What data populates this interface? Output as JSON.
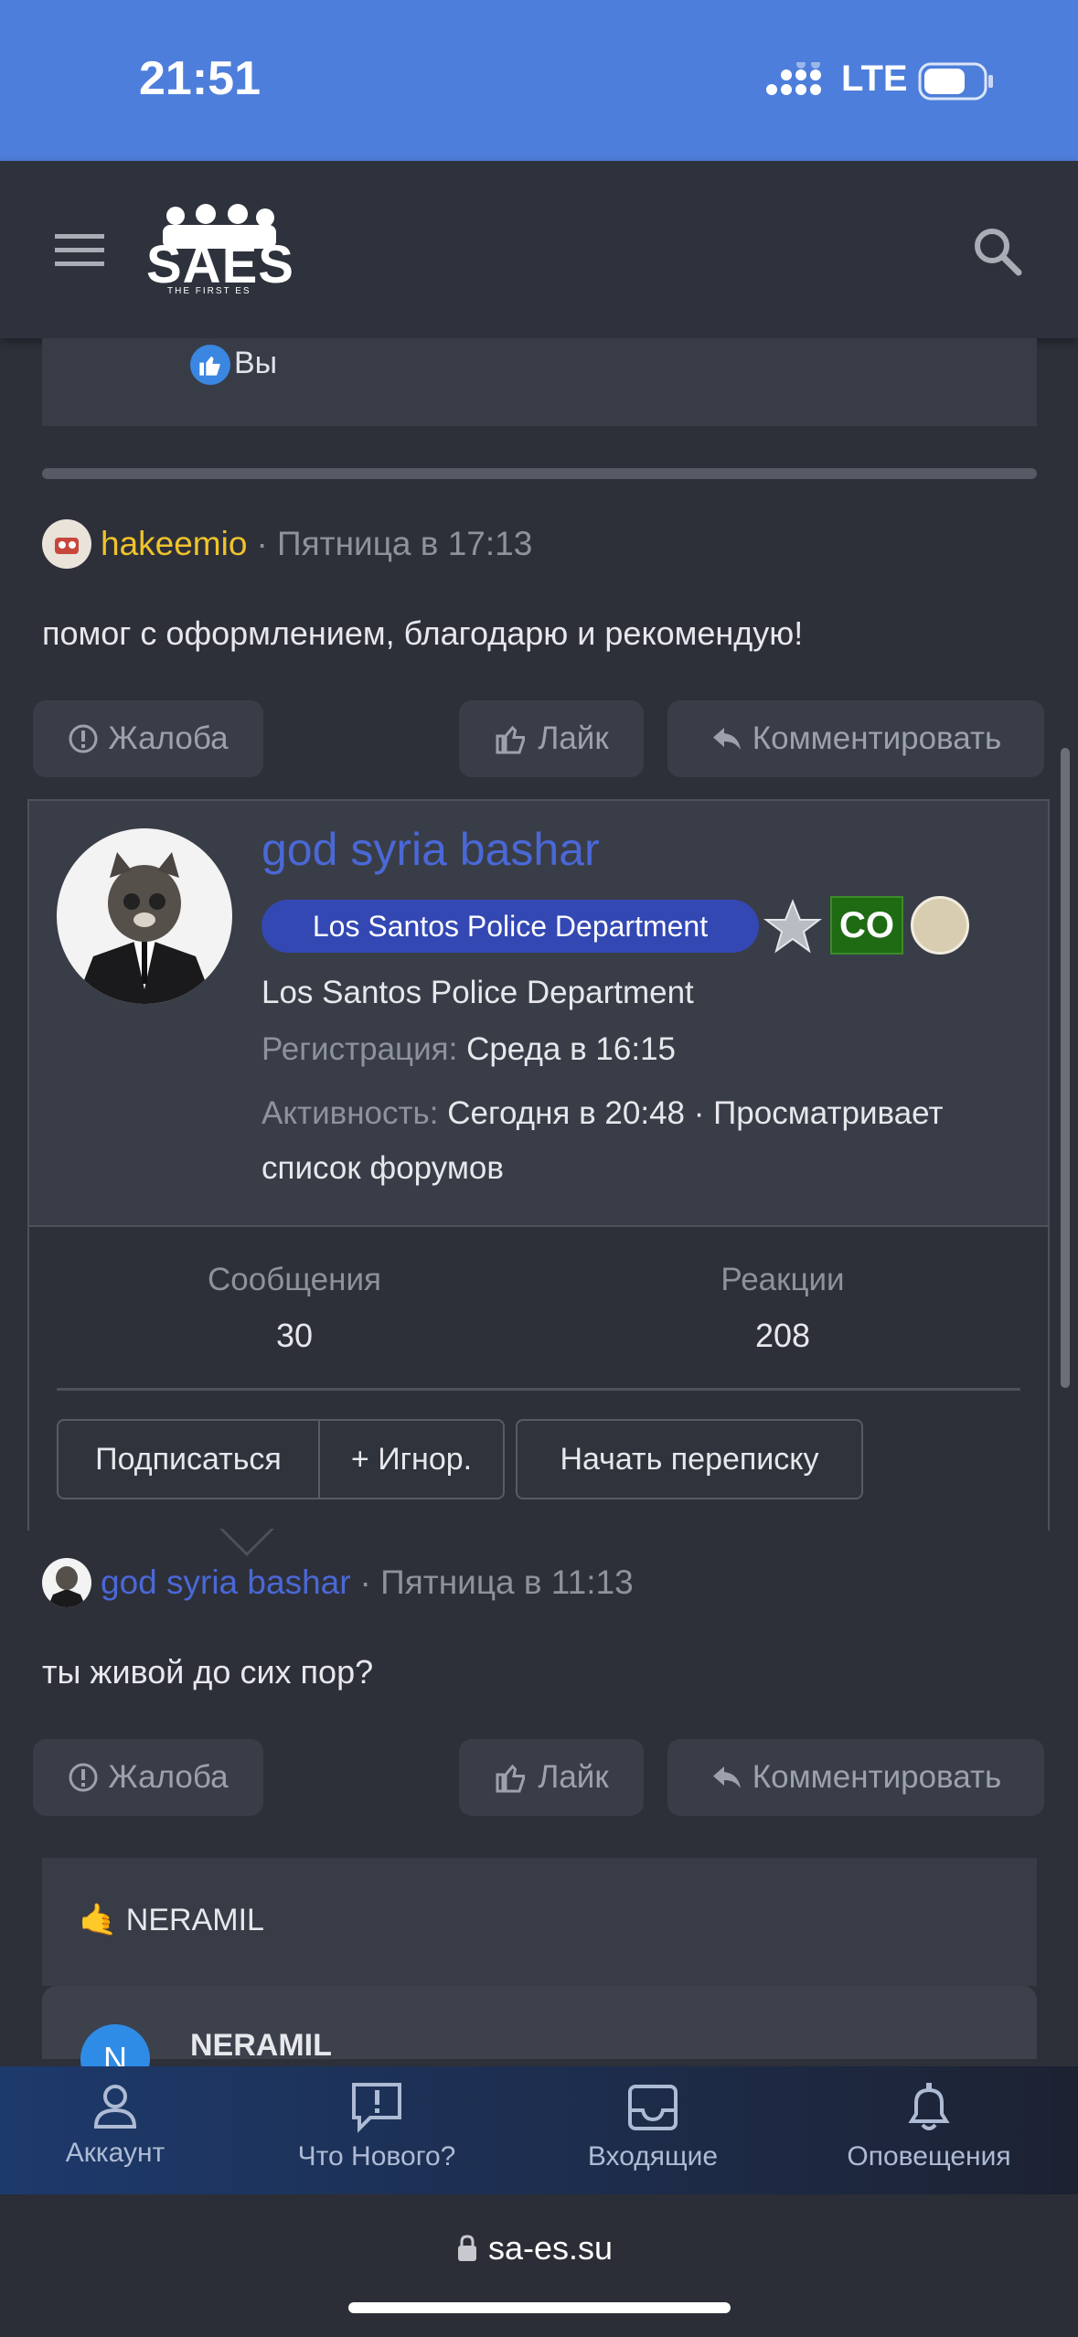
{
  "status_bar": {
    "time": "21:51",
    "network": "LTE"
  },
  "header": {
    "logo_text": "SAES",
    "logo_sub": "THE FIRST ES",
    "menu_icon": "hamburger-icon",
    "search_icon": "search-icon"
  },
  "prev_reactions": {
    "text": "Вы"
  },
  "post1": {
    "author": "hakeemio",
    "time": "· Пятница в 17:13",
    "text": "помог с оформлением, благодарю и рекомендую!",
    "report": "Жалоба",
    "like": "Лайк",
    "comment": "Комментировать"
  },
  "profile_card": {
    "name": "god syria bashar",
    "group_badge": "Los Santos Police Department",
    "rank_badge": "CO",
    "title": "Los Santos Police Department",
    "registration_label": "Регистрация:",
    "registration_value": "Среда в 16:15",
    "activity_label": "Активность:",
    "activity_value": "Сегодня в 20:48 · Просматривает",
    "activity_value2": "список форумов",
    "stats": [
      {
        "label": "Сообщения",
        "value": "30"
      },
      {
        "label": "Реакции",
        "value": "208"
      }
    ],
    "follow": "Подписаться",
    "ignore": "+ Игнор.",
    "message": "Начать переписку"
  },
  "post2": {
    "author": "god syria bashar",
    "time": "· Пятница в 11:13",
    "text": "ты живой до сих пор?",
    "report": "Жалоба",
    "like": "Лайк",
    "comment": "Комментировать"
  },
  "reply_block": {
    "title": "🤙 NERAMIL",
    "sub_author": "NERAMIL",
    "sub_avatar_letter": "N"
  },
  "tabbar": [
    {
      "label": "Аккаунт",
      "icon": "account-icon"
    },
    {
      "label": "Что Нового?",
      "icon": "whats-new-icon"
    },
    {
      "label": "Входящие",
      "icon": "inbox-icon"
    },
    {
      "label": "Оповещения",
      "icon": "bell-icon"
    }
  ],
  "url": "sa-es.su"
}
